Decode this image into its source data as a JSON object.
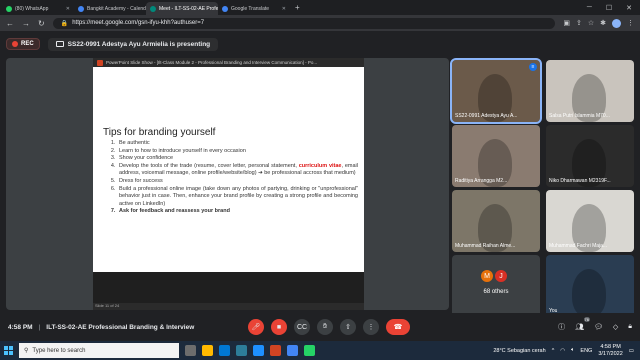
{
  "browser": {
    "tabs": [
      {
        "label": "(80) WhatsApp",
        "color": "#25d366",
        "active": false
      },
      {
        "label": "Bangkit Academy - Calendar - M",
        "color": "#4285f4",
        "active": false
      },
      {
        "label": "Meet - ILT-SS-02-AE Profes",
        "color": "#00897b",
        "active": true
      },
      {
        "label": "Google Translate",
        "color": "#4285f4",
        "active": false
      }
    ],
    "url": "https://meet.google.com/gsn-ifyu-khh?authuser=7"
  },
  "meet": {
    "rec_label": "REC",
    "presenting_text": "SS22-0991 Adestya Ayu Armielia is presenting",
    "ppt_window_title": "PowerPoint Slide Show - [Ilt-Class Module 2 - Professional Branding and Interview Communication] - Po...",
    "slide": {
      "title": "Tips for branding yourself",
      "items": [
        {
          "text": "Be authentic"
        },
        {
          "text": "Learn to how to introduce yourself in every occasion"
        },
        {
          "text": "Show your confidence"
        },
        {
          "pre": "Develop the tools of the trade (resume, cover letter, personal statement, ",
          "red": "curriculum vitae",
          "post": ", email address, voicemail message, online profile/website/blog) ➔ be professional accross that medium)"
        },
        {
          "text": "Dress for success"
        },
        {
          "text": "Build a professional online image (take down any photos of partying, drinking or \"unprofessional\" behavior just in case. Then, enhance your brand profile by creating a strong profile and becoming active on LinkedIn)"
        },
        {
          "text": "Ask for feedback and reassess your brand",
          "bold": true
        }
      ],
      "status_text": "Slide 11 of 24"
    },
    "participants": [
      {
        "name": "SS22-0991 Adestya Ayu A...",
        "bg": "#6b5a4a",
        "active": true
      },
      {
        "name": "Salsa Putri Islammia M70...",
        "bg": "#c9c4bd"
      },
      {
        "name": "Raditiya Arrangga M2...",
        "bg": "#8a7b70"
      },
      {
        "name": "Niko Dharmawan M2319F...",
        "bg": "#2b2b2b"
      },
      {
        "name": "Muhammad Raihan Alme...",
        "bg": "#7d7668"
      },
      {
        "name": "Muhammad Fachri Maja...",
        "bg": "#d9d7d2"
      },
      {
        "name": "You",
        "bg": "#2a3d52"
      }
    ],
    "others": {
      "initials": [
        "M",
        "J"
      ],
      "colors": [
        "#e8710a",
        "#d93025"
      ],
      "label": "68 others"
    },
    "time": "4:58 PM",
    "meeting_name": "ILT-SS-02-AE Professional Branding & Interview",
    "people_count": "76"
  },
  "taskbar": {
    "search_placeholder": "Type here to search",
    "weather": "28°C  Sebagian cerah",
    "lang": "ENG",
    "clock_time": "4:58 PM",
    "clock_date": "3/17/2022"
  }
}
